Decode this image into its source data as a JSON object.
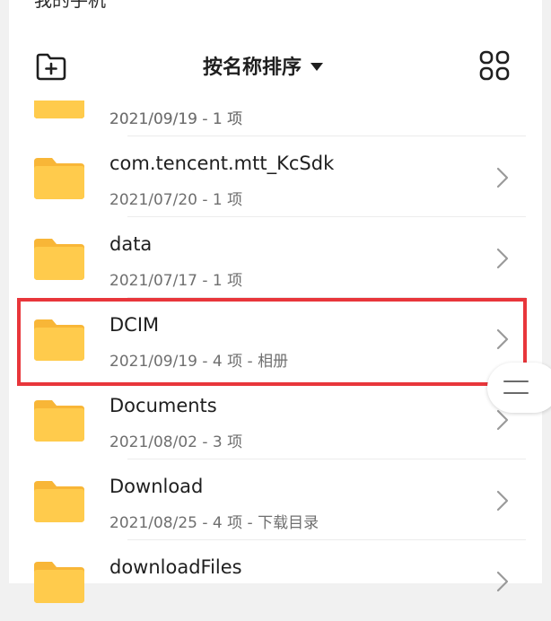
{
  "header": {
    "title": "我的手机"
  },
  "toolbar": {
    "sort_label": "按名称排序",
    "new_folder_icon": "new-folder-icon",
    "view_toggle_icon": "grid-view-icon"
  },
  "colors": {
    "folder": "#FFCB4C",
    "folder_tab": "#F8B637",
    "highlight": "#E8363B",
    "chevron": "#9A9A9A"
  },
  "folders": [
    {
      "name": "",
      "meta": "2021/09/19 - 1 项"
    },
    {
      "name": "com.tencent.mtt_KcSdk",
      "meta": "2021/07/20 - 1 项"
    },
    {
      "name": "data",
      "meta": "2021/07/17 - 1 项"
    },
    {
      "name": "DCIM",
      "meta": "2021/09/19 - 4 项 - 相册"
    },
    {
      "name": "Documents",
      "meta": "2021/08/02 - 3 项"
    },
    {
      "name": "Download",
      "meta": "2021/08/25 - 4 项 - 下载目录"
    },
    {
      "name": "downloadFiles",
      "meta": ""
    }
  ]
}
